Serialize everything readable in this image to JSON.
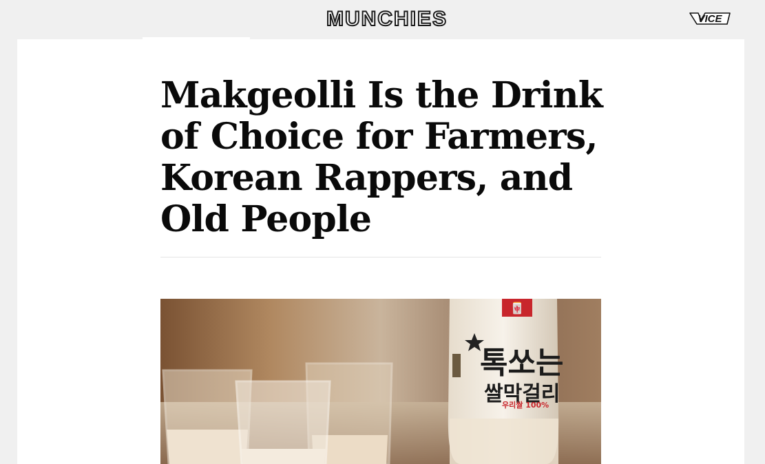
{
  "header": {
    "brand": "MUNCHIES",
    "network_logo": "VICE"
  },
  "article": {
    "headline": "Makgeolli Is the Drink of Choice for Farmers, Korean Rappers, and Old People"
  },
  "hero_image": {
    "bottle_label_top": "🀄",
    "bottle_label_main_line1": "톡쏘는",
    "bottle_label_main_line2": "쌀막걸리",
    "bottle_label_small": "우리쌀 100%"
  },
  "colors": {
    "background": "#f0f0f0",
    "card": "#ffffff",
    "text": "#0a0a0a",
    "rule": "#e4e4e4"
  }
}
